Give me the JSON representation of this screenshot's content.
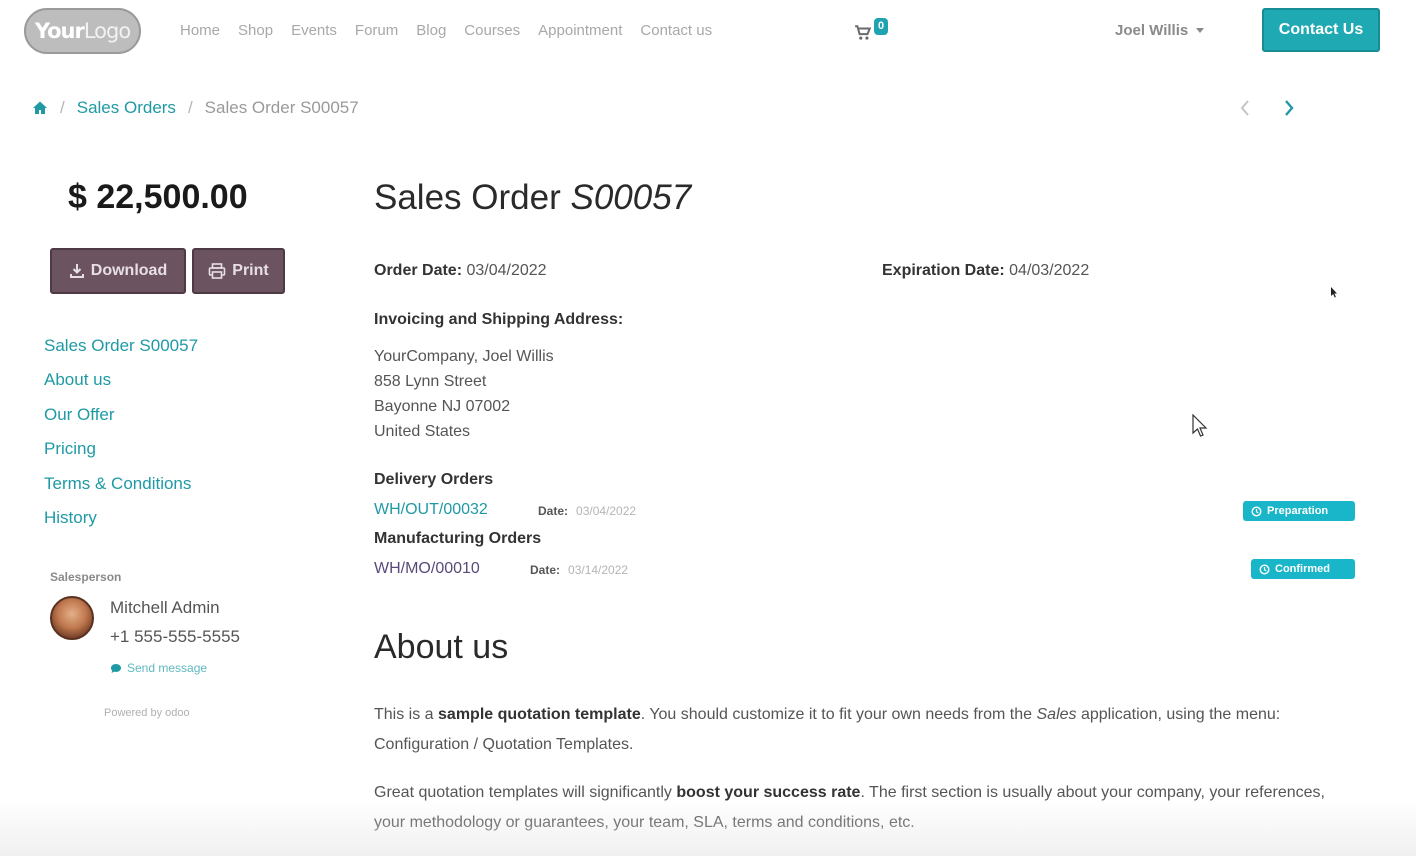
{
  "header": {
    "logo": {
      "part1": "Your",
      "part2": "Logo"
    },
    "nav": [
      "Home",
      "Shop",
      "Events",
      "Forum",
      "Blog",
      "Courses",
      "Appointment",
      "Contact us"
    ],
    "cart_count": "0",
    "user_name": "Joel Willis",
    "contact_button": "Contact Us"
  },
  "breadcrumb": {
    "items": [
      "Sales Orders"
    ],
    "current": "Sales Order S00057"
  },
  "sidebar": {
    "amount": "$ 22,500.00",
    "download_label": "Download",
    "print_label": "Print",
    "toc": [
      "Sales Order S00057",
      "About us",
      "Our Offer",
      "Pricing",
      "Terms & Conditions",
      "History"
    ],
    "salesperson_label": "Salesperson",
    "salesperson_name": "Mitchell Admin",
    "salesperson_phone": "+1 555-555-5555",
    "send_message": "Send message",
    "powered_by": "Powered by odoo"
  },
  "main": {
    "title_prefix": "Sales Order",
    "title_number": "S00057",
    "order_date_label": "Order Date:",
    "order_date": "03/04/2022",
    "expiration_label": "Expiration Date:",
    "expiration_date": "04/03/2022",
    "address_label": "Invoicing and Shipping Address:",
    "address_lines": [
      "YourCompany, Joel Willis",
      "858 Lynn Street",
      "Bayonne NJ 07002",
      "United States"
    ],
    "delivery_label": "Delivery Orders",
    "delivery_ref": "WH/OUT/00032",
    "delivery_date_label": "Date:",
    "delivery_date": "03/04/2022",
    "delivery_status": "Preparation",
    "manufacturing_label": "Manufacturing Orders",
    "manufacturing_ref": "WH/MO/00010",
    "manufacturing_date_label": "Date:",
    "manufacturing_date": "03/14/2022",
    "manufacturing_status": "Confirmed",
    "about_heading": "About us",
    "p1": {
      "a": "This is a ",
      "b": "sample quotation template",
      "c": ". You should customize it to fit your own needs from the ",
      "d": "Sales",
      "e": " application, using the menu: Configuration / Quotation Templates."
    },
    "p2": {
      "a": "Great quotation templates will significantly ",
      "b": "boost your success rate",
      "c": ". The first section is usually about your company, your references, your methodology or guarantees, your team, SLA, terms and conditions, etc."
    }
  },
  "colors": {
    "accent": "#1fa9b3",
    "link": "#1f9aa5",
    "dark_button": "#6b5360",
    "badge": "#19b6c9"
  }
}
